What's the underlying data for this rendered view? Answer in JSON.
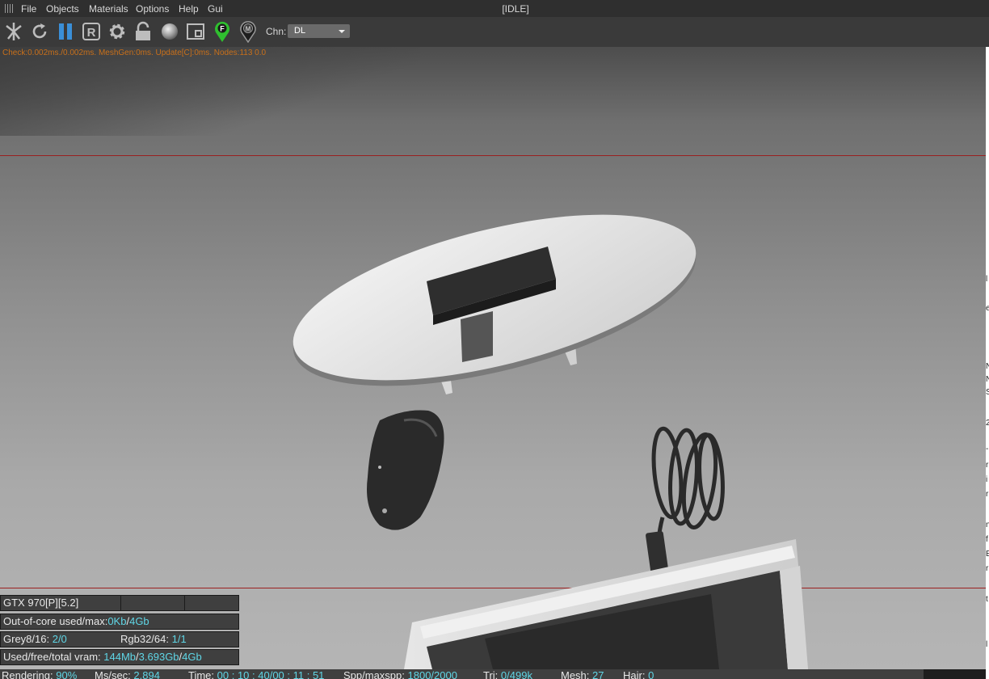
{
  "menu": {
    "items": [
      "File",
      "Objects",
      "Materials",
      "Options",
      "Help",
      "Gui"
    ],
    "title": "[IDLE]"
  },
  "toolbar": {
    "icons": [
      "send-scene-icon",
      "restart-icon",
      "pause-icon",
      "region-render-icon",
      "settings-icon",
      "lock-icon",
      "material-sphere-icon",
      "viewport-icon",
      "focus-pick-icon",
      "material-pick-icon"
    ],
    "focus_badge": "F",
    "material_badge": "M",
    "chn_label": "Chn:",
    "chn_value": "DL",
    "accent_green": "#2fbf2f",
    "accent_blue": "#3a8fd8"
  },
  "viewport": {
    "stats_text": "Check:0.002ms./0.002ms. MeshGen:0ms. Update[C]:0ms. Nodes:113  0.0"
  },
  "info": {
    "gpu": "GTX 970[P][5.2]",
    "ooc_label": "Out-of-core used/max:",
    "ooc_used": "0Kb",
    "ooc_max": "4Gb",
    "grey_label": "Grey8/16:",
    "grey_value": "2/0",
    "rgb_label": "Rgb32/64:",
    "rgb_value": "1/1",
    "vram_label": "Used/free/total vram:",
    "vram_used": "144Mb",
    "vram_free": "3.693Gb",
    "vram_total": "4Gb"
  },
  "status": {
    "rendering_label": "Rendering:",
    "rendering_value": "90%",
    "ms_label": "Ms/sec:",
    "ms_value": "2.894",
    "time_label": "Time:",
    "time_value": "00 : 10 : 40/00 : 11 : 51",
    "spp_label": "Spp/maxspp:",
    "spp_value": "1800/2000",
    "tri_label": "Tri:",
    "tri_value": "0/499k",
    "mesh_label": "Mesh:",
    "mesh_value": "27",
    "hair_label": "Hair:",
    "hair_value": "0"
  },
  "right_edge": {
    "chars": [
      "l",
      "e",
      "N",
      "N",
      "S",
      "2",
      "-",
      "r",
      "i",
      "r",
      "n",
      "f",
      "E",
      "r",
      "t",
      "l"
    ]
  }
}
